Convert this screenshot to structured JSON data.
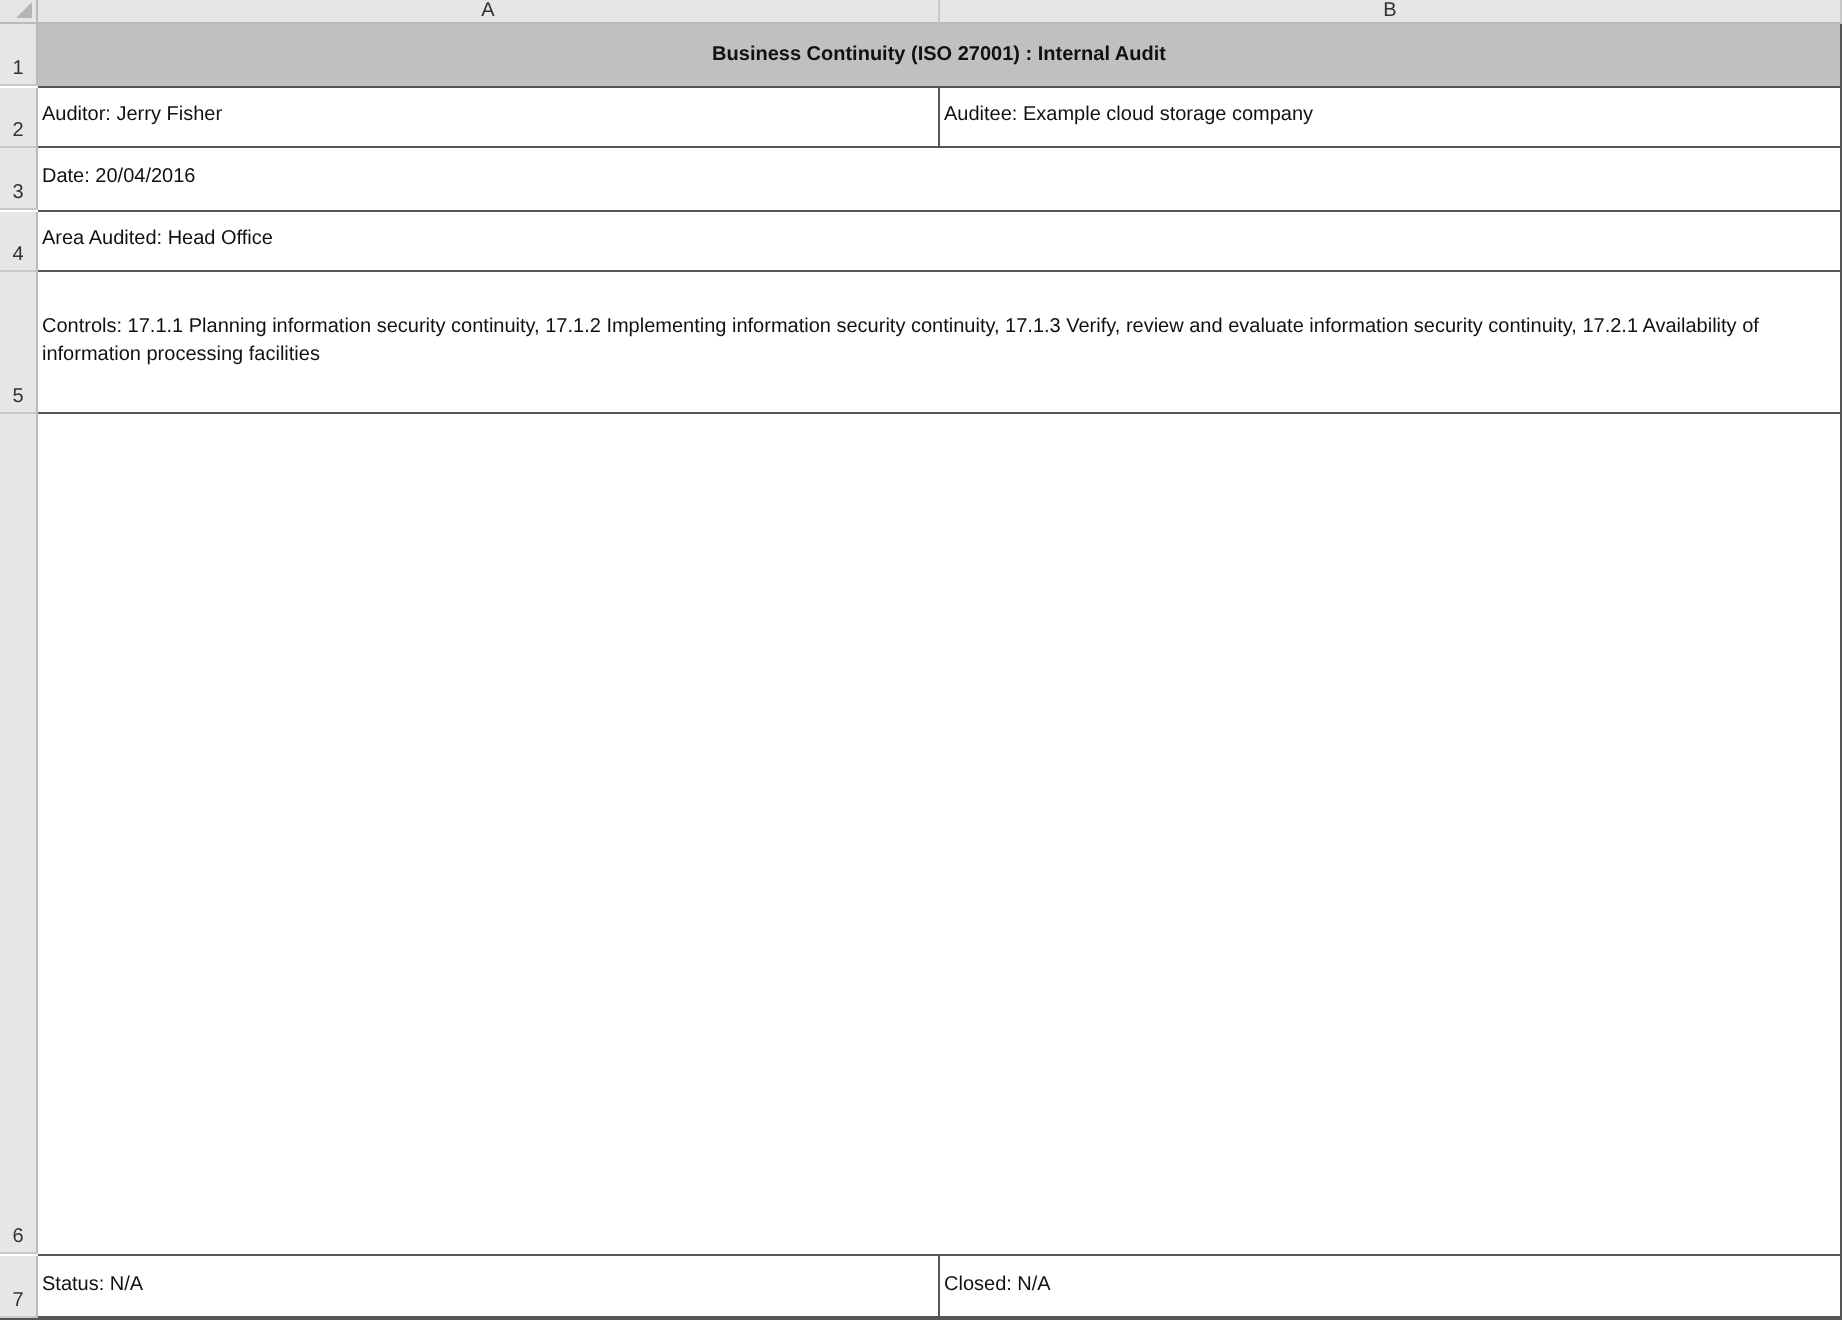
{
  "columns": [
    "A",
    "B"
  ],
  "rows": [
    {
      "number": "1",
      "kind": "title",
      "cells": [
        "Business Continuity (ISO 27001) : Internal Audit"
      ]
    },
    {
      "number": "2",
      "kind": "data",
      "cells": [
        "Auditor: Jerry Fisher",
        "Auditee: Example cloud storage company"
      ]
    },
    {
      "number": "3",
      "kind": "data",
      "cells": [
        "Date: 20/04/2016"
      ]
    },
    {
      "number": "4",
      "kind": "data",
      "cells": [
        "Area Audited: Head Office"
      ]
    },
    {
      "number": "5",
      "kind": "data",
      "cells": [
        "Controls: 17.1.1 Planning information security continuity, 17.1.2 Implementing information security continuity, 17.1.3 Verify, review and evaluate information security continuity, 17.2.1 Availability of information processing facilities"
      ]
    },
    {
      "number": "6",
      "kind": "data"
    },
    {
      "number": "7",
      "kind": "data",
      "cells": [
        "Status: N/A",
        "Closed: N/A"
      ]
    }
  ]
}
